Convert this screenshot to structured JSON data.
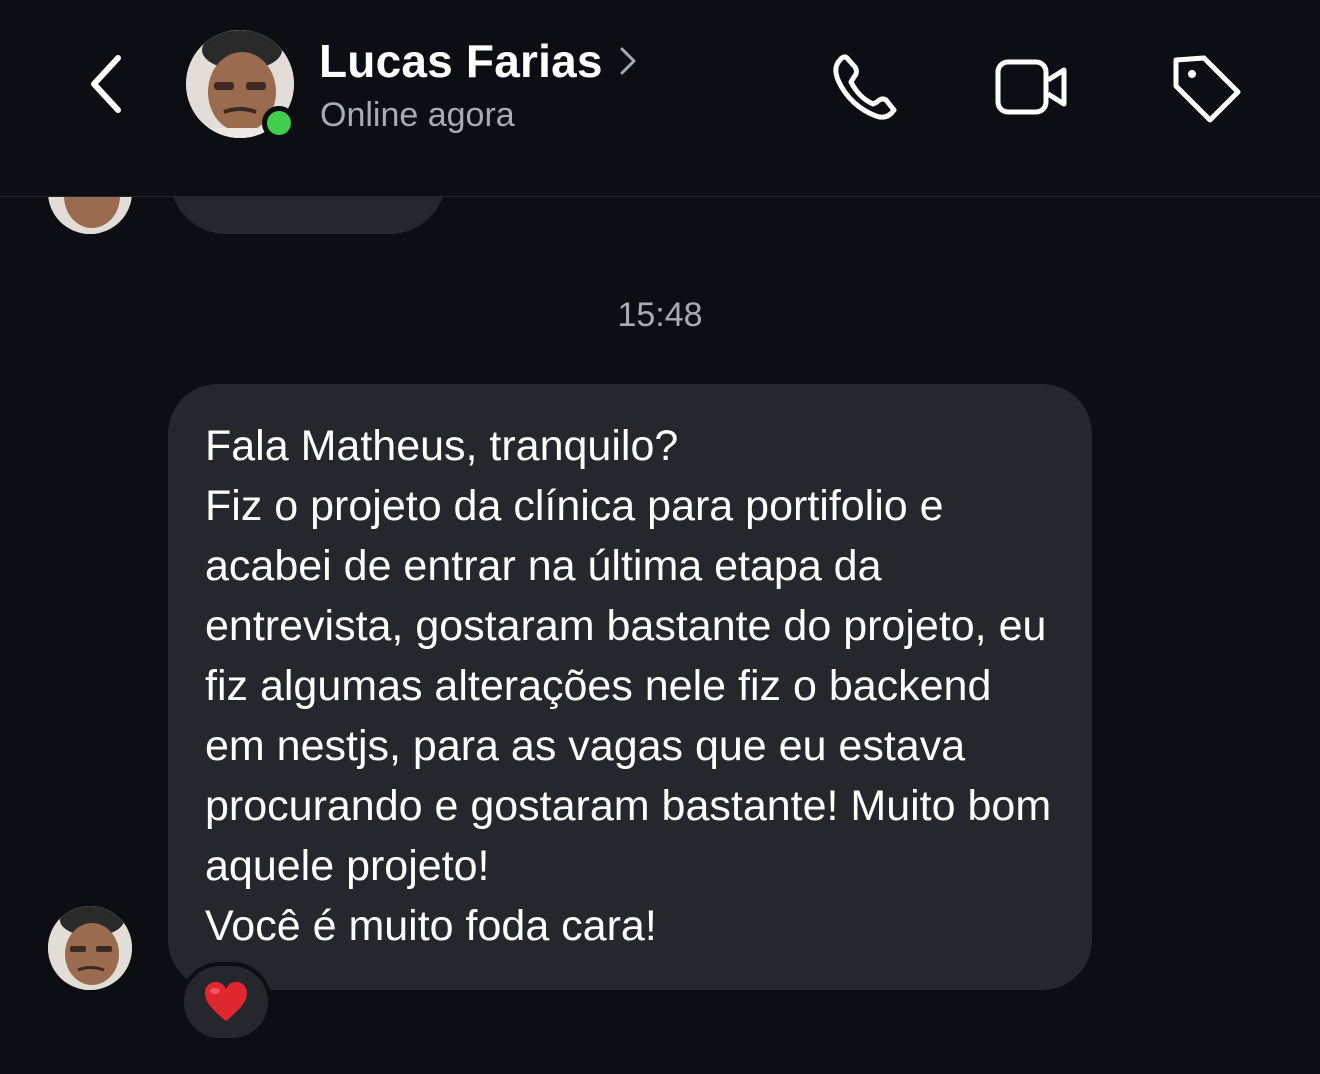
{
  "header": {
    "contact_name": "Lucas Farias",
    "status": "Online agora",
    "back_icon": "chevron-left-icon",
    "name_chevron_icon": "chevron-right-icon",
    "actions": [
      "phone-icon",
      "video-camera-icon",
      "tag-icon"
    ],
    "online_color": "#3fcf4d"
  },
  "chat": {
    "timestamp": "15:48",
    "message": {
      "sender": "Lucas Farias",
      "text": "Fala Matheus, tranquilo?\nFiz o projeto da clínica para portifolio e acabei de entrar na última etapa da entrevista, gostaram bastante do projeto, eu fiz algumas alterações nele fiz o backend em nestjs, para as vagas que eu estava procurando e gostaram bastante! Muito bom aquele projeto!\nVocê é muito foda cara!",
      "reaction": "❤️"
    }
  },
  "colors": {
    "background": "#0c0e13",
    "bubble": "#25272c",
    "secondary_text": "#a8abb2"
  }
}
